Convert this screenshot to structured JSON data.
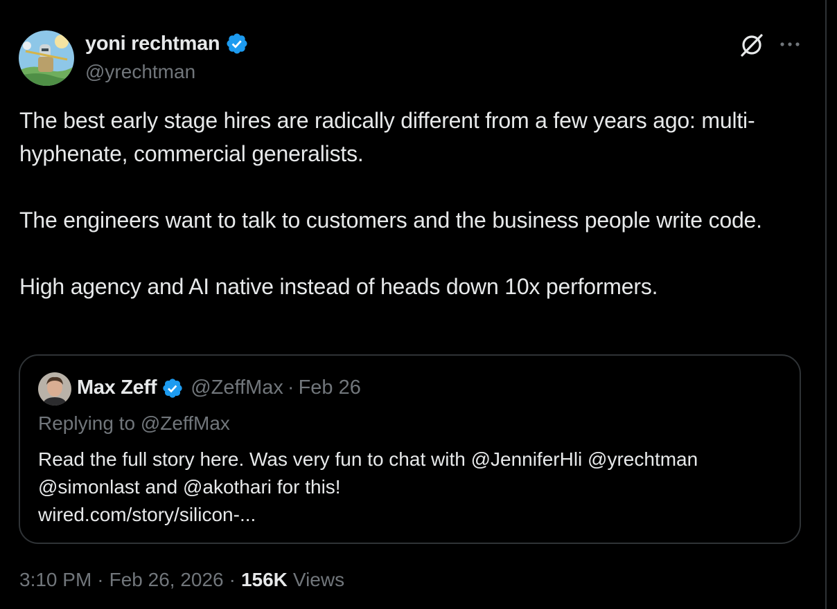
{
  "author": {
    "name": "yoni rechtman",
    "handle": "@yrechtman",
    "verified": true
  },
  "tweet": {
    "paragraphs": [
      "The best early stage hires are radically different from a few years ago: multi-hyphenate, commercial generalists.",
      "The engineers want to talk to customers and the business people write code.",
      "High agency and AI native instead of heads down 10x performers."
    ]
  },
  "quoted_tweet": {
    "name": "Max Zeff",
    "handle": "@ZeffMax",
    "separator": "·",
    "date": "Feb 26",
    "replying_to": "Replying to @ZeffMax",
    "text_lines": [
      "Read the full story here. Was very fun to chat with @JenniferHli @yrechtman",
      "@simonlast and @akothari for  this!",
      "wired.com/story/silicon-..."
    ]
  },
  "meta": {
    "time": "3:10 PM",
    "date": "Feb 26, 2026",
    "separator": "·",
    "views_count": "156K",
    "views_label": "Views"
  },
  "icons": {
    "verified": "verified-badge-icon",
    "grok": "grok-icon",
    "more": "more-options-icon"
  },
  "colors": {
    "background": "#000000",
    "text_primary": "#e7e9ea",
    "text_secondary": "#71767b",
    "border": "#2f3336",
    "verified_blue": "#1d9bf0"
  }
}
